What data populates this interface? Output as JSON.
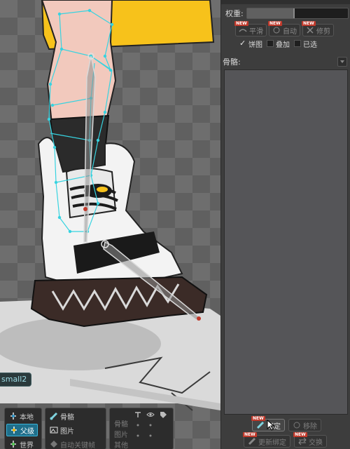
{
  "viewport": {
    "skin_label": "small2",
    "tools": {
      "space_group": [
        {
          "label": "本地",
          "icon": "local-axis-icon",
          "active": false
        },
        {
          "label": "父级",
          "icon": "parent-axis-icon",
          "active": true
        },
        {
          "label": "世界",
          "icon": "world-axis-icon",
          "active": false
        }
      ],
      "select_group": [
        {
          "label": "骨骼",
          "icon": "bone-icon"
        },
        {
          "label": "图片",
          "icon": "image-icon"
        },
        {
          "label": "自动关键帧",
          "icon": "autokey-icon"
        }
      ],
      "visibility_group": {
        "rows": [
          "骨骼",
          "图片",
          "其他"
        ]
      }
    }
  },
  "panel": {
    "weight": {
      "label": "权重:",
      "value": 0.47
    },
    "buttons": {
      "smooth": "平滑",
      "auto": "自动",
      "prune": "修剪"
    },
    "checks": [
      {
        "label": "饼图",
        "checked": true
      },
      {
        "label": "叠加",
        "checked": false
      },
      {
        "label": "已选",
        "checked": false
      }
    ],
    "bones_label": "骨骼:",
    "bottom": {
      "bind": "绑定",
      "remove": "移除",
      "update_bind": "更新绑定",
      "swap": "交换"
    },
    "accent_color": "#1f6f8b",
    "tag_color": "#c0392b"
  }
}
